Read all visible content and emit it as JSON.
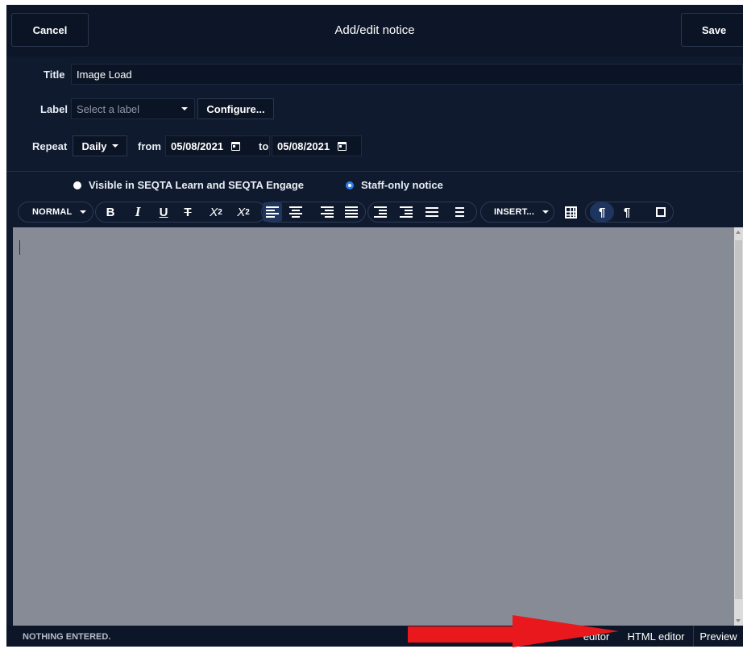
{
  "header": {
    "cancel_label": "Cancel",
    "title": "Add/edit notice",
    "save_label": "Save"
  },
  "form": {
    "title_label": "Title",
    "title_value": "Image Load",
    "label_label": "Label",
    "label_placeholder": "Select a label",
    "configure_label": "Configure...",
    "repeat_label": "Repeat",
    "repeat_value": "Daily",
    "from_label": "from",
    "from_date": "05/08/2021",
    "to_label": "to",
    "to_date": "05/08/2021"
  },
  "visibility": {
    "option1": "Visible in SEQTA Learn and SEQTA Engage",
    "option2": "Staff-only notice",
    "selected": "option2"
  },
  "toolbar": {
    "format_label": "NORMAL",
    "bold": "B",
    "italic": "I",
    "underline": "U",
    "strike": "T",
    "subscript_base": "X",
    "subscript_mark": "2",
    "superscript_base": "X",
    "superscript_mark": "2",
    "insert_label": "INSERT...",
    "ltr_glyph": "¶",
    "rtl_glyph": "¶",
    "icons": [
      "align-left-icon",
      "align-center-icon",
      "align-right-icon",
      "align-justify-icon",
      "indent-icon",
      "outdent-icon",
      "bullet-list-icon",
      "numbered-list-icon",
      "table-icon",
      "ltr-icon",
      "rtl-icon",
      "fullscreen-icon"
    ]
  },
  "footer": {
    "status": "NOTHING ENTERED.",
    "tab_visual": "editor",
    "tab_html": "HTML editor",
    "tab_preview": "Preview"
  },
  "colors": {
    "background": "#0f1a2e",
    "editor": "#878b96",
    "accent": "#2d7ff0",
    "annotation_arrow": "#e8181c"
  }
}
